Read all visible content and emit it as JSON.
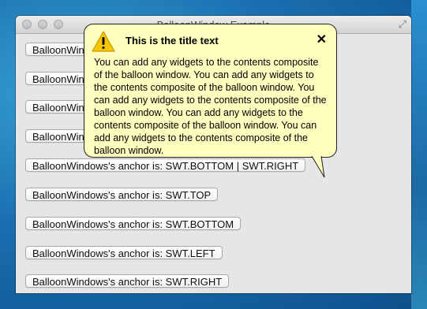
{
  "window": {
    "title": "BalloonWindow Example",
    "fullscreen_glyph": "⤢"
  },
  "buttons": [
    "BalloonWindows's anchor is:  SWT.TOP | SWT.LEFT",
    "BalloonWindows's anchor is:  SWT.TOP | SWT.RIGHT",
    "BalloonWindows's anchor is:  SWT.BOTTOM | SWT.LEFT",
    "BalloonWindows's anchor is:  SWT.BOTTOM | SWT.CENTER",
    "BalloonWindows's anchor is:  SWT.BOTTOM | SWT.RIGHT",
    "BalloonWindows's anchor is:  SWT.TOP",
    "BalloonWindows's anchor is:  SWT.BOTTOM",
    "BalloonWindows's anchor is:  SWT.LEFT",
    "BalloonWindows's anchor is:  SWT.RIGHT"
  ],
  "balloon": {
    "icon": "warning-icon",
    "title": "This is the title text",
    "close_glyph": "✕",
    "body": "You can add any widgets to the contents composite of the balloon window. You can add any widgets to the contents composite of the balloon window. You can add any widgets to the contents composite of the balloon window. You can add any widgets to the contents composite of the balloon window. You can add any widgets to the contents composite of the balloon window.",
    "background": "#ffffc0"
  }
}
